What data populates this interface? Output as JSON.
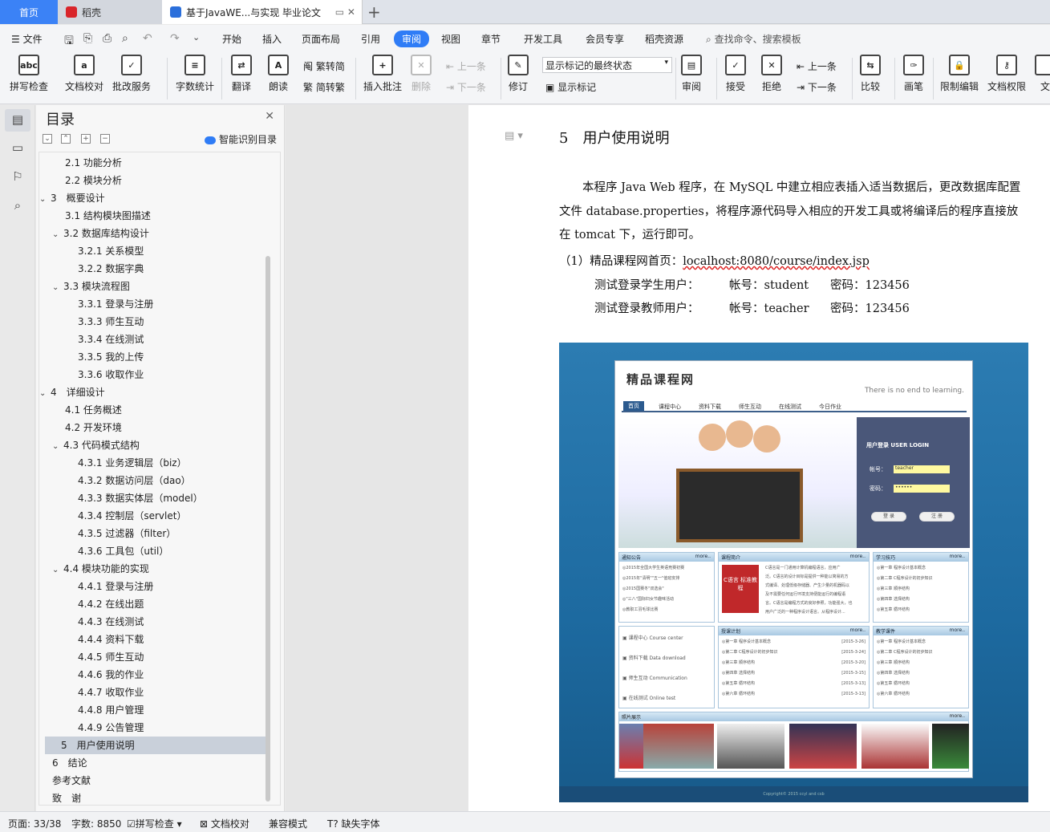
{
  "tabs": {
    "home": "首页",
    "wps": "稻壳",
    "doc": "基于JavaWE...与实现 毕业论文"
  },
  "menu": {
    "file": "文件",
    "items": [
      "开始",
      "插入",
      "页面布局",
      "引用",
      "审阅",
      "视图",
      "章节",
      "开发工具",
      "会员专享",
      "稻壳资源"
    ],
    "active": "审阅",
    "search": "查找命令、搜索模板"
  },
  "ribbon": {
    "spell": "拼写检查",
    "doc_check": "文档校对",
    "batch": "批改服务",
    "word_count": "字数统计",
    "translate": "翻译",
    "read": "朗读",
    "to_simplified": "繁转简",
    "to_traditional": "简转繁",
    "insert_comment": "插入批注",
    "delete": "删除",
    "prev": "上一条",
    "next": "下一条",
    "revise": "修订",
    "markup_state": "显示标记的最终状态",
    "show_markup": "显示标记",
    "review": "审阅",
    "accept": "接受",
    "reject": "拒绝",
    "prev2": "上一条",
    "next2": "下一条",
    "compare": "比较",
    "pen": "画笔",
    "restrict": "限制编辑",
    "perm": "文档权限",
    "more": "文"
  },
  "toc": {
    "title": "目录",
    "smart": "智能识别目录",
    "items": [
      {
        "label": "2.1 功能分析",
        "level": 2
      },
      {
        "label": "2.2 模块分析",
        "level": 2
      },
      {
        "label": "3　概要设计",
        "level": 1,
        "tog": "v"
      },
      {
        "label": "3.1 结构模块图描述",
        "level": 2
      },
      {
        "label": "3.2 数据库结构设计",
        "level": 2,
        "tog": "v"
      },
      {
        "label": "3.2.1  关系模型",
        "level": 3
      },
      {
        "label": "3.2.2  数据字典",
        "level": 3
      },
      {
        "label": "3.3 模块流程图",
        "level": 2,
        "tog": "v"
      },
      {
        "label": "3.3.1  登录与注册",
        "level": 3
      },
      {
        "label": "3.3.3  师生互动",
        "level": 3
      },
      {
        "label": "3.3.4  在线测试",
        "level": 3
      },
      {
        "label": "3.3.5  我的上传",
        "level": 3
      },
      {
        "label": "3.3.6  收取作业",
        "level": 3
      },
      {
        "label": "4　详细设计",
        "level": 1,
        "tog": "v"
      },
      {
        "label": "4.1 任务概述",
        "level": 2
      },
      {
        "label": "4.2 开发环境",
        "level": 2
      },
      {
        "label": "4.3 代码模式结构",
        "level": 2,
        "tog": "v"
      },
      {
        "label": "4.3.1  业务逻辑层（biz）",
        "level": 3
      },
      {
        "label": "4.3.2  数据访问层（dao）",
        "level": 3
      },
      {
        "label": "4.3.3  数据实体层（model）",
        "level": 3
      },
      {
        "label": "4.3.4  控制层（servlet）",
        "level": 3
      },
      {
        "label": "4.3.5  过滤器（filter）",
        "level": 3
      },
      {
        "label": "4.3.6  工具包（util）",
        "level": 3
      },
      {
        "label": "4.4 模块功能的实现",
        "level": 2,
        "tog": "v"
      },
      {
        "label": "4.4.1  登录与注册",
        "level": 3
      },
      {
        "label": "4.4.2  在线出题",
        "level": 3
      },
      {
        "label": "4.4.3  在线测试",
        "level": 3
      },
      {
        "label": "4.4.4  资料下载",
        "level": 3
      },
      {
        "label": "4.4.5  师生互动",
        "level": 3
      },
      {
        "label": "4.4.6  我的作业",
        "level": 3
      },
      {
        "label": "4.4.7  收取作业",
        "level": 3
      },
      {
        "label": "4.4.8  用户管理",
        "level": 3
      },
      {
        "label": "4.4.9  公告管理",
        "level": 3
      },
      {
        "label": "5　用户使用说明",
        "level": 1,
        "active": true
      },
      {
        "label": "6　结论",
        "level": 1
      },
      {
        "label": "参考文献",
        "level": 1
      },
      {
        "label": "致　谢",
        "level": 1
      }
    ]
  },
  "doc": {
    "heading_num": "5",
    "heading": "用户使用说明",
    "para1": "本程序 Java Web 程序，在 MySQL 中建立相应表插入适当数据后，更改数据库配置文件 database.properties，将程序源代码导入相应的开发工具或将编译后的程序直接放在 tomcat 下，运行即可。",
    "item1_prefix": "（1）精品课程网首页：",
    "item1_url": "localhost:8080/course/index.jsp",
    "student_label": "测试登录学生用户：",
    "student_account": "帐号：student",
    "student_pwd": "密码：123456",
    "teacher_label": "测试登录教师用户：",
    "teacher_account": "帐号：teacher",
    "teacher_pwd": "密码：123456"
  },
  "site": {
    "logo": "精品课程网",
    "tagline": "There is no end to learning.",
    "nav": [
      "首页",
      "课程中心",
      "资料下载",
      "师生互动",
      "在线测试",
      "今日作业"
    ],
    "login_title": "用户登录 USER LOGIN",
    "account_label": "帐号：",
    "account_value": "teacher",
    "password_label": "密码：",
    "password_value": "••••••",
    "login_btn": "登 录",
    "register_btn": "注 册",
    "notice_title": "通知公告",
    "intro_title": "课程简介",
    "skills_title": "学习技巧",
    "plan_title": "授课计划",
    "courseware_title": "教学课件",
    "photos_title": "照片展示",
    "more": "more..",
    "notices": [
      "2015年全国大学生英语竞赛初赛",
      "2015年\"清明\"\"五一\"值班安排",
      "2015国赛冬\"双选会\"",
      "\"三八\"国际妇女节趣味活动",
      "教职工羽毛球比赛"
    ],
    "book_label": "C语言 标准教程",
    "intro_text": [
      "C语言是一门通用计算机编程语言，应用广",
      "泛。C语言的设计目标是提供一种能以简易的方",
      "式编译、处理低级存储器、产生少量的机器码以",
      "及不需要任何运行环境支持便能运行的编程语",
      "言。C语言是编程方式的良好参照，功能强大，也",
      "用户广泛的一种程序设计语言。从程序设计..."
    ],
    "skills": [
      "第一章  程序设计基本概念",
      "第二章  C程序设计的初步知识",
      "第三章  顺序结构",
      "第四章  选择结构",
      "第五章  循环结构"
    ],
    "quick": [
      "课程中心 Course center",
      "资料下载 Data download",
      "师生互动 Communication",
      "在线测试 Online test"
    ],
    "plan": [
      [
        "第一章  程序设计基本概念",
        "[2015-3-26]"
      ],
      [
        "第二章  C程序设计的初步知识",
        "[2015-3-24]"
      ],
      [
        "第三章  顺序结构",
        "[2015-3-20]"
      ],
      [
        "第四章  选择结构",
        "[2015-3-15]"
      ],
      [
        "第五章  循环结构",
        "[2015-3-13]"
      ],
      [
        "第六章  循环结构",
        "[2015-3-13]"
      ]
    ],
    "courseware": [
      "第一章  程序设计基本概念",
      "第二章  C程序设计的初步知识",
      "第三章  顺序结构",
      "第四章  选择结构",
      "第五章  循环结构",
      "第六章  循环结构"
    ],
    "footer": "Copyright© 2015 ccyl and csb"
  },
  "status": {
    "page": "页面: 33/38",
    "words": "字数: 8850",
    "spell": "拼写检查",
    "check": "文档校对",
    "compat": "兼容模式",
    "missing_font": "缺失字体"
  }
}
